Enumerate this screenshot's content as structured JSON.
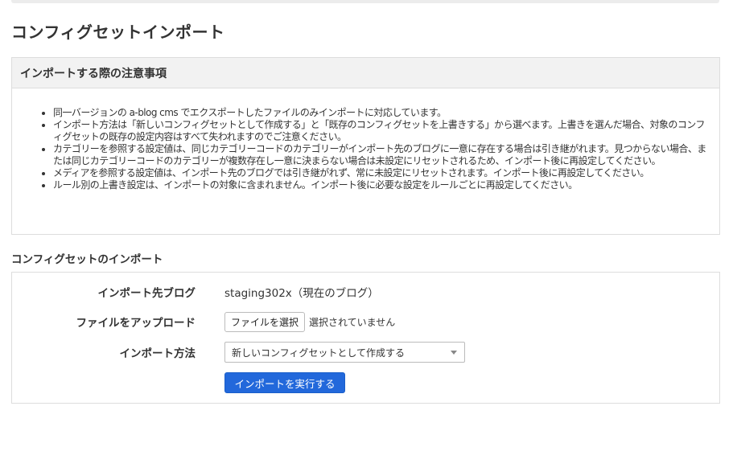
{
  "page": {
    "title": "コンフィグセットインポート"
  },
  "notice": {
    "heading": "インポートする際の注意事項",
    "items": [
      "同一バージョンの a-blog cms でエクスポートしたファイルのみインポートに対応しています。",
      "インポート方法は「新しいコンフィグセットとして作成する」と「既存のコンフィグセットを上書きする」から選べます。上書きを選んだ場合、対象のコンフィグセットの既存の設定内容はすべて失われますのでご注意ください。",
      "カテゴリーを参照する設定値は、同じカテゴリーコードのカテゴリーがインポート先のブログに一意に存在する場合は引き継がれます。見つからない場合、または同じカテゴリーコードのカテゴリーが複数存在し一意に決まらない場合は未設定にリセットされるため、インポート後に再設定してください。",
      "メディアを参照する設定値は、インポート先のブログでは引き継がれず、常に未設定にリセットされます。インポート後に再設定してください。",
      "ルール別の上書き設定は、インポートの対象に含まれません。インポート後に必要な設定をルールごとに再設定してください。"
    ]
  },
  "import_section": {
    "title": "コンフィグセットのインポート",
    "target_blog": {
      "label": "インポート先ブログ",
      "value": "staging302x（現在のブログ）"
    },
    "file_upload": {
      "label": "ファイルをアップロード",
      "button_label": "ファイルを選択",
      "status": "選択されていません"
    },
    "method": {
      "label": "インポート方法",
      "selected": "新しいコンフィグセットとして作成する"
    },
    "submit_label": "インポートを実行する"
  },
  "colors": {
    "accent": "#2268db",
    "border": "#dddddd",
    "header_bg": "#f2f2f2"
  },
  "icons": {
    "select_arrow": "chevron-down-icon"
  }
}
